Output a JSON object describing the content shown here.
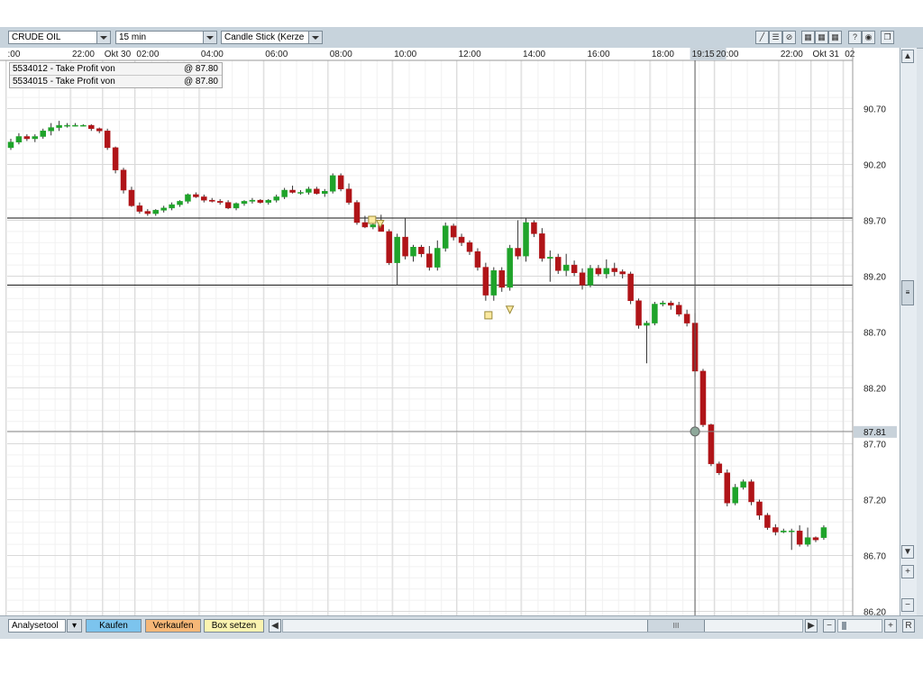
{
  "toolbar": {
    "instrument": "CRUDE OIL",
    "interval": "15 min",
    "chart_style": "Candle Stick (Kerze"
  },
  "orders": [
    {
      "label": "5534012 - Take Profit von",
      "price": "@ 87.80"
    },
    {
      "label": "5534015 - Take Profit von",
      "price": "@ 87.80"
    }
  ],
  "bottom": {
    "analysis_tool": "Analysetool",
    "buy": "Kaufen",
    "sell": "Verkaufen",
    "set_box": "Box setzen",
    "scroll_grip": "III",
    "zoom_out": "−",
    "zoom_in": "+",
    "reset": "R"
  },
  "colors": {
    "up": "#1fa32a",
    "down": "#b01418",
    "price_tag": "#c8d2da",
    "crosshair": "#555555"
  },
  "chart_data": {
    "type": "candlestick",
    "instrument": "CRUDE OIL",
    "interval": "15 min",
    "y_ticks": [
      "90.70",
      "90.20",
      "89.70",
      "89.20",
      "88.70",
      "88.20",
      "87.70",
      "87.20",
      "86.70",
      "86.20"
    ],
    "ylim": [
      86.2,
      90.7
    ],
    "x_ticks": [
      {
        "label": ":00",
        "bar": 0
      },
      {
        "label": "22:00",
        "bar": 8
      },
      {
        "label": "Okt 30",
        "bar": 12
      },
      {
        "label": "02:00",
        "bar": 16
      },
      {
        "label": "04:00",
        "bar": 24
      },
      {
        "label": "06:00",
        "bar": 32
      },
      {
        "label": "08:00",
        "bar": 40
      },
      {
        "label": "10:00",
        "bar": 48
      },
      {
        "label": "12:00",
        "bar": 56
      },
      {
        "label": "14:00",
        "bar": 64
      },
      {
        "label": "16:00",
        "bar": 72
      },
      {
        "label": "18:00",
        "bar": 80
      },
      {
        "label": "19:15",
        "bar": 85
      },
      {
        "label": "20:00",
        "bar": 88
      },
      {
        "label": "22:00",
        "bar": 96
      },
      {
        "label": "Okt 31",
        "bar": 100
      },
      {
        "label": "02",
        "bar": 104
      }
    ],
    "crosshair": {
      "time": "19:15",
      "price": "87.81"
    },
    "horizontal_lines": [
      89.72,
      89.12
    ],
    "candles": [
      [
        90.35,
        90.43,
        90.33,
        90.4
      ],
      [
        90.4,
        90.48,
        90.38,
        90.45
      ],
      [
        90.45,
        90.47,
        90.41,
        90.43
      ],
      [
        90.43,
        90.47,
        90.4,
        90.45
      ],
      [
        90.45,
        90.52,
        90.43,
        90.5
      ],
      [
        90.5,
        90.57,
        90.46,
        90.53
      ],
      [
        90.53,
        90.59,
        90.5,
        90.55
      ],
      [
        90.55,
        90.57,
        90.53,
        90.55
      ],
      [
        90.55,
        90.57,
        90.54,
        90.55
      ],
      [
        90.55,
        90.56,
        90.54,
        90.55
      ],
      [
        90.55,
        90.56,
        90.5,
        90.52
      ],
      [
        90.52,
        90.53,
        90.48,
        90.5
      ],
      [
        90.5,
        90.52,
        90.33,
        90.35
      ],
      [
        90.35,
        90.36,
        90.12,
        90.15
      ],
      [
        90.15,
        90.17,
        89.94,
        89.97
      ],
      [
        89.97,
        90.0,
        89.82,
        89.83
      ],
      [
        89.83,
        89.86,
        89.76,
        89.78
      ],
      [
        89.78,
        89.8,
        89.74,
        89.76
      ],
      [
        89.76,
        89.8,
        89.74,
        89.79
      ],
      [
        89.79,
        89.83,
        89.77,
        89.81
      ],
      [
        89.81,
        89.86,
        89.79,
        89.84
      ],
      [
        89.84,
        89.88,
        89.82,
        89.87
      ],
      [
        89.87,
        89.94,
        89.85,
        89.93
      ],
      [
        89.93,
        89.95,
        89.9,
        89.91
      ],
      [
        89.91,
        89.93,
        89.86,
        89.88
      ],
      [
        89.88,
        89.9,
        89.86,
        89.87
      ],
      [
        89.87,
        89.89,
        89.84,
        89.86
      ],
      [
        89.86,
        89.88,
        89.8,
        89.81
      ],
      [
        89.81,
        89.86,
        89.79,
        89.85
      ],
      [
        89.85,
        89.88,
        89.83,
        89.87
      ],
      [
        89.87,
        89.9,
        89.85,
        89.88
      ],
      [
        89.88,
        89.89,
        89.85,
        89.86
      ],
      [
        89.86,
        89.89,
        89.84,
        89.88
      ],
      [
        89.88,
        89.93,
        89.86,
        89.91
      ],
      [
        89.91,
        89.99,
        89.89,
        89.97
      ],
      [
        89.97,
        90.01,
        89.94,
        89.95
      ],
      [
        89.95,
        89.97,
        89.93,
        89.95
      ],
      [
        89.95,
        90.0,
        89.93,
        89.98
      ],
      [
        89.98,
        90.0,
        89.93,
        89.94
      ],
      [
        89.94,
        89.98,
        89.91,
        89.96
      ],
      [
        89.96,
        90.12,
        89.94,
        90.1
      ],
      [
        90.1,
        90.12,
        89.96,
        89.98
      ],
      [
        89.98,
        90.03,
        89.84,
        89.86
      ],
      [
        89.86,
        89.88,
        89.66,
        89.68
      ],
      [
        89.68,
        89.74,
        89.63,
        89.64
      ],
      [
        89.64,
        89.7,
        89.62,
        89.66
      ],
      [
        89.66,
        89.75,
        89.6,
        89.6
      ],
      [
        89.6,
        89.62,
        89.3,
        89.32
      ],
      [
        89.32,
        89.58,
        89.12,
        89.55
      ],
      [
        89.55,
        89.72,
        89.35,
        89.38
      ],
      [
        89.38,
        89.48,
        89.33,
        89.46
      ],
      [
        89.46,
        89.48,
        89.37,
        89.4
      ],
      [
        89.4,
        89.47,
        89.25,
        89.28
      ],
      [
        89.28,
        89.52,
        89.25,
        89.45
      ],
      [
        89.45,
        89.68,
        89.42,
        89.65
      ],
      [
        89.65,
        89.67,
        89.52,
        89.55
      ],
      [
        89.55,
        89.58,
        89.47,
        89.5
      ],
      [
        89.5,
        89.52,
        89.39,
        89.42
      ],
      [
        89.42,
        89.45,
        89.25,
        89.28
      ],
      [
        89.28,
        89.32,
        88.98,
        89.03
      ],
      [
        89.03,
        89.28,
        88.98,
        89.25
      ],
      [
        89.25,
        89.28,
        89.06,
        89.1
      ],
      [
        89.1,
        89.48,
        89.07,
        89.45
      ],
      [
        89.45,
        89.7,
        89.35,
        89.38
      ],
      [
        89.38,
        89.72,
        89.33,
        89.68
      ],
      [
        89.68,
        89.7,
        89.55,
        89.58
      ],
      [
        89.58,
        89.63,
        89.33,
        89.36
      ],
      [
        89.36,
        89.43,
        89.15,
        89.37
      ],
      [
        89.37,
        89.4,
        89.22,
        89.25
      ],
      [
        89.25,
        89.4,
        89.2,
        89.3
      ],
      [
        89.3,
        89.34,
        89.2,
        89.23
      ],
      [
        89.23,
        89.27,
        89.08,
        89.12
      ],
      [
        89.12,
        89.3,
        89.1,
        89.27
      ],
      [
        89.27,
        89.3,
        89.2,
        89.22
      ],
      [
        89.22,
        89.35,
        89.18,
        89.27
      ],
      [
        89.27,
        89.32,
        89.2,
        89.24
      ],
      [
        89.24,
        89.26,
        89.18,
        89.22
      ],
      [
        89.22,
        89.24,
        88.95,
        88.98
      ],
      [
        88.98,
        89.0,
        88.73,
        88.76
      ],
      [
        88.76,
        88.8,
        88.42,
        88.78
      ],
      [
        88.78,
        88.97,
        88.76,
        88.95
      ],
      [
        88.95,
        88.98,
        88.93,
        88.96
      ],
      [
        88.96,
        88.98,
        88.9,
        88.94
      ],
      [
        88.94,
        88.97,
        88.84,
        88.86
      ],
      [
        88.86,
        88.9,
        88.75,
        88.78
      ],
      [
        88.78,
        88.87,
        88.3,
        88.35
      ],
      [
        88.35,
        88.37,
        87.85,
        87.87
      ],
      [
        87.87,
        87.88,
        87.5,
        87.52
      ],
      [
        87.52,
        87.54,
        87.42,
        87.44
      ],
      [
        87.44,
        87.47,
        87.14,
        87.17
      ],
      [
        87.17,
        87.34,
        87.15,
        87.31
      ],
      [
        87.31,
        87.38,
        87.29,
        87.36
      ],
      [
        87.36,
        87.38,
        87.15,
        87.18
      ],
      [
        87.18,
        87.2,
        87.02,
        87.06
      ],
      [
        87.06,
        87.08,
        86.93,
        86.95
      ],
      [
        86.95,
        86.98,
        86.88,
        86.91
      ],
      [
        86.91,
        86.94,
        86.9,
        86.92
      ],
      [
        86.92,
        86.94,
        86.75,
        86.92
      ],
      [
        86.92,
        86.97,
        86.78,
        86.8
      ],
      [
        86.8,
        86.95,
        86.78,
        86.86
      ],
      [
        86.86,
        86.87,
        86.82,
        86.84
      ],
      [
        86.86,
        86.97,
        86.84,
        86.95
      ]
    ]
  }
}
